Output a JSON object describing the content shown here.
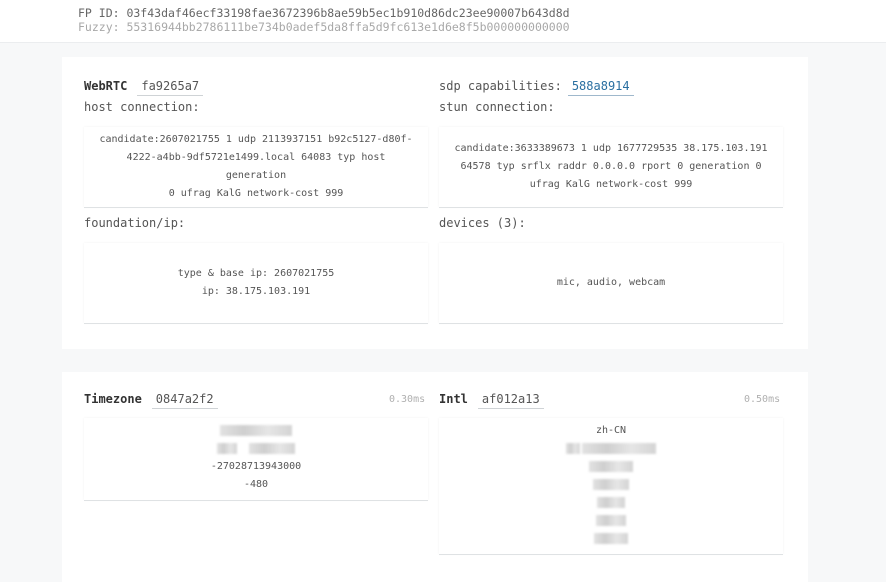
{
  "header": {
    "fp_id": "FP ID: 03f43daf46ecf33198fae3672396b8ae59b5ec1b910d86dc23ee90007b643d8d",
    "fuzzy": "Fuzzy: 55316944bb2786111be734b0adef5da8ffa5d9fc613e1d6e8f5b000000000000"
  },
  "webrtc": {
    "title": "WebRTC",
    "hash": "fa9265a7",
    "sdp_label": "sdp capabilities:",
    "sdp_hash": "588a8914",
    "host_label": "host connection:",
    "host_text": [
      "candidate:2607021755 1 udp 2113937151 b92c5127-d80f-",
      "4222-a4bb-9df5721e1499.local 64083 typ host generation",
      "0 ufrag KalG network-cost 999"
    ],
    "stun_label": "stun connection:",
    "stun_text": [
      "candidate:3633389673 1 udp 1677729535 38.175.103.191",
      "64578 typ srflx raddr 0.0.0.0 rport 0 generation 0",
      "ufrag KalG network-cost 999"
    ],
    "foundation_label": "foundation/ip:",
    "foundation_text": [
      "type & base ip: 2607021755",
      "ip: 38.175.103.191"
    ],
    "devices_label": "devices (3):",
    "devices_text": "mic, audio, webcam"
  },
  "timezone": {
    "title": "Timezone",
    "hash": "0847a2f2",
    "time": "0.30ms",
    "values": [
      "-27028713943000",
      "-480"
    ]
  },
  "intl": {
    "title": "Intl",
    "hash": "af012a13",
    "time": "0.50ms",
    "locale": "zh-CN"
  },
  "colors": {
    "link": "#2a6fa1",
    "background": "#f7f8f9",
    "card": "#ffffff"
  }
}
